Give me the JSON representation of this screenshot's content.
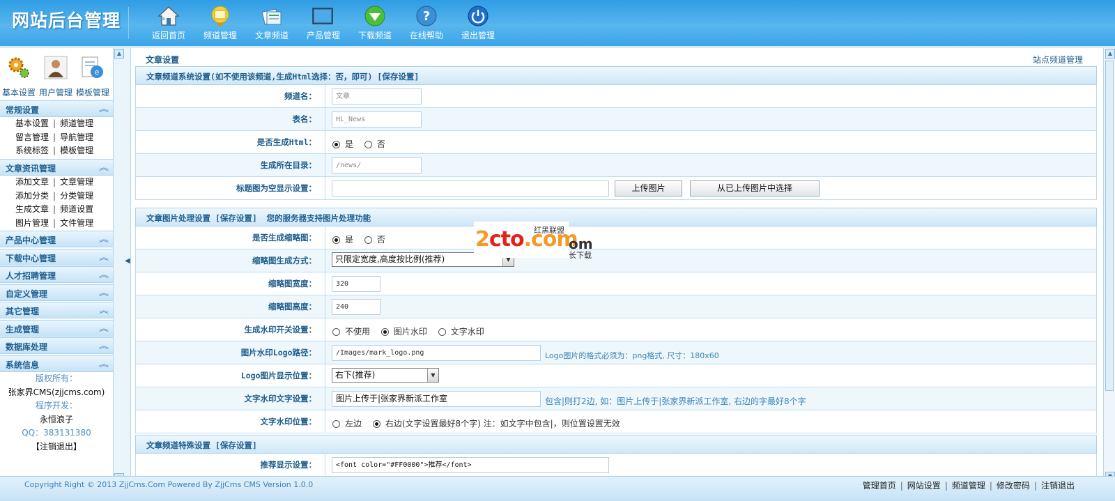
{
  "app": {
    "title": "网站后台管理"
  },
  "nav": [
    {
      "label": "返回首页",
      "icon": "house-icon"
    },
    {
      "label": "频道管理",
      "icon": "monitor-icon"
    },
    {
      "label": "文章频道",
      "icon": "articles-icon"
    },
    {
      "label": "产品管理",
      "icon": "screen-icon"
    },
    {
      "label": "下载频道",
      "icon": "download-icon"
    },
    {
      "label": "在线帮助",
      "icon": "help-icon"
    },
    {
      "label": "退出管理",
      "icon": "power-icon"
    }
  ],
  "quick": [
    {
      "label": "基本设置",
      "icon": "gear-icon"
    },
    {
      "label": "用户管理",
      "icon": "user-icon"
    },
    {
      "label": "模板管理",
      "icon": "template-icon"
    }
  ],
  "sidebar": {
    "groups": [
      {
        "title": "常规设置",
        "rows": [
          [
            "基本设置",
            "频道管理"
          ],
          [
            "留言管理",
            "导航管理"
          ],
          [
            "系统标签",
            "模板管理"
          ]
        ]
      },
      {
        "title": "文章资讯管理",
        "rows": [
          [
            "添加文章",
            "文章管理"
          ],
          [
            "添加分类",
            "分类管理"
          ],
          [
            "生成文章",
            "频道设置"
          ],
          [
            "图片管理",
            "文件管理"
          ]
        ]
      },
      {
        "title": "产品中心管理"
      },
      {
        "title": "下载中心管理"
      },
      {
        "title": "人才招聘管理"
      },
      {
        "title": "自定义管理"
      },
      {
        "title": "其它管理"
      },
      {
        "title": "生成管理"
      },
      {
        "title": "数据库处理"
      },
      {
        "title": "系统信息"
      }
    ],
    "info": {
      "copyright_label": "版权所有：",
      "copyright_value": "张家界CMS(zjjcms.com)",
      "dev_label": "程序开发：",
      "dev_value": "永恒浪子",
      "qq": "QQ：383131380",
      "logout": "【注销退出】"
    }
  },
  "main": {
    "title": "文章设置",
    "right_link": "站点频道管理",
    "section1": {
      "title": "文章频道系统设置(如不使用该频道,生成Html选择：否，即可)",
      "save": "[保存设置]"
    },
    "channel_name": {
      "label": "频道名：",
      "value": "文章"
    },
    "table_name": {
      "label": "表名：",
      "value": "HL_News"
    },
    "gen_html": {
      "label": "是否生成Html：",
      "yes": "是",
      "no": "否"
    },
    "gen_dir": {
      "label": "生成所在目录：",
      "value": "/news/"
    },
    "title_img": {
      "label": "标题图为空显示设置：",
      "value": "",
      "upload": "上传图片",
      "choose": "从已上传图片中选择"
    },
    "section2": {
      "title": "文章图片处理设置",
      "save": "[保存设置]",
      "note": "您的服务器支持图片处理功能"
    },
    "gen_thumb": {
      "label": "是否生成缩略图：",
      "yes": "是",
      "no": "否"
    },
    "thumb_mode": {
      "label": "缩略图生成方式：",
      "value": "只限定宽度,高度按比例(推荐)"
    },
    "thumb_width": {
      "label": "缩略图宽度：",
      "value": "320"
    },
    "thumb_height": {
      "label": "缩略图高度：",
      "value": "240"
    },
    "watermark_switch": {
      "label": "生成水印开关设置：",
      "opt1": "不使用",
      "opt2": "图片水印",
      "opt3": "文字水印"
    },
    "logo_path": {
      "label": "图片水印Logo路径：",
      "value": "/Images/mark_logo.png",
      "hint": "Logo图片的格式必须为：png格式, 尺寸：180x60"
    },
    "logo_pos": {
      "label": "Logo图片显示位置：",
      "value": "右下(推荐)"
    },
    "text_wm": {
      "label": "文字水印文字设置：",
      "value": "图片上传于|张家界新派工作室",
      "hint": "包含|则打2边, 如：图片上传于|张家界新派工作室, 右边的字最好8个字"
    },
    "text_wm_pos": {
      "label": "文字水印位置：",
      "left": "左边",
      "right": "右边(文字设置最好8个字) 注：如文字中包含|，则位置设置无效"
    },
    "section3": {
      "title": "文章频道特殊设置",
      "save": "[保存设置]"
    },
    "recommend": {
      "label": "推荐显示设置：",
      "value": "<font color=\"#FF0000\">推荐</font>"
    }
  },
  "watermark": {
    "brand": "2cto.com",
    "cn": "红黑联盟",
    "suffix": "om",
    "suffix2": "长下载"
  },
  "footer": {
    "copyright": "Copyright Right © 2013 ZjjCms.Com Powered By ZjjCms CMS Version 1.0.0",
    "links": [
      "管理首页",
      "网站设置",
      "频道管理",
      "修改密码",
      "注销退出"
    ]
  },
  "colors": {
    "accent": "#3aa4e7",
    "label": "#1d5c8b",
    "hint": "#3a84b5"
  }
}
